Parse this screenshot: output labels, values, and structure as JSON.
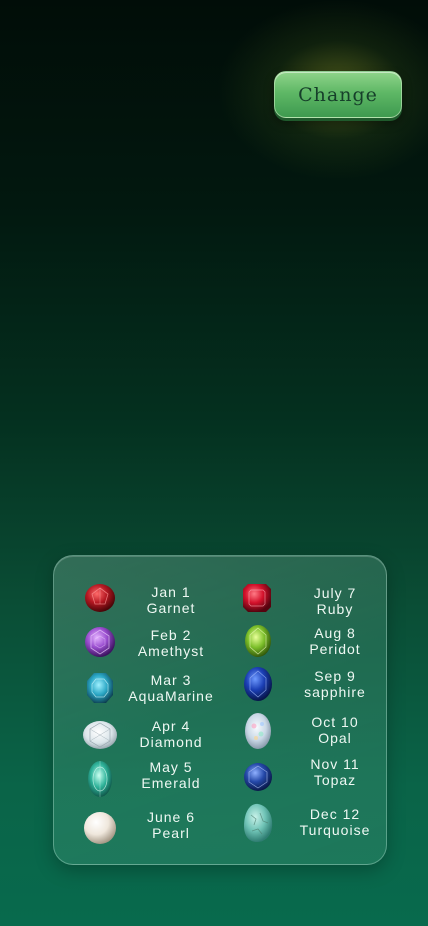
{
  "change_button": {
    "label": "Change"
  },
  "birthstones": {
    "left": [
      {
        "date": "Jan 1",
        "stone": "Garnet",
        "icon": "garnet-icon",
        "color": "#b51822"
      },
      {
        "date": "Feb 2",
        "stone": "Amethyst",
        "icon": "amethyst-icon",
        "color": "#9b4fd0"
      },
      {
        "date": "Mar 3",
        "stone": "AquaMarine",
        "icon": "aquamarine-icon",
        "color": "#2aa6c4"
      },
      {
        "date": "Apr 4",
        "stone": "Diamond",
        "icon": "diamond-icon",
        "color": "#e6eef2"
      },
      {
        "date": "May 5",
        "stone": "Emerald",
        "icon": "emerald-icon",
        "color": "#2fb39a"
      },
      {
        "date": "June 6",
        "stone": "Pearl",
        "icon": "pearl-icon",
        "color": "#efe7dc"
      }
    ],
    "right": [
      {
        "date": "July 7",
        "stone": "Ruby",
        "icon": "ruby-icon",
        "color": "#d3112b"
      },
      {
        "date": "Aug 8",
        "stone": "Peridot",
        "icon": "peridot-icon",
        "color": "#7cbf2a"
      },
      {
        "date": "Sep 9",
        "stone": "sapphire",
        "icon": "sapphire-icon",
        "color": "#1b3fb5"
      },
      {
        "date": "Oct 10",
        "stone": "Opal",
        "icon": "opal-icon",
        "color": "#c9d8e6"
      },
      {
        "date": "Nov 11",
        "stone": "Topaz",
        "icon": "topaz-icon",
        "color": "#2448a8"
      },
      {
        "date": "Dec 12",
        "stone": "Turquoise",
        "icon": "turquoise-icon",
        "color": "#6fc3b6"
      }
    ]
  }
}
